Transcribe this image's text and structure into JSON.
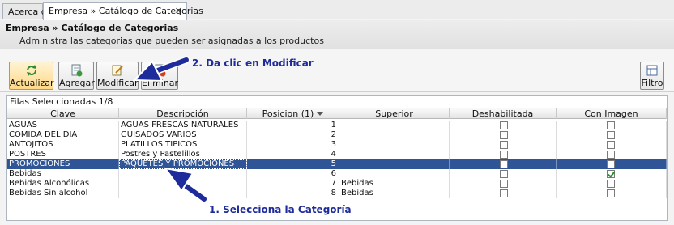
{
  "tabs": [
    {
      "label": "Acerca de"
    },
    {
      "label": "Empresa » Catálogo de Categorias",
      "close": "✕"
    }
  ],
  "header": {
    "title": "Empresa » Catálogo de Categorias",
    "description": "Administra las categorias que pueden ser asignadas a los productos"
  },
  "toolbar": {
    "actualizar": "Actualizar",
    "agregar": "Agregar",
    "modificar": "Modificar",
    "eliminar": "Eliminar",
    "filtro": "Filtro"
  },
  "grid": {
    "selected_label": "Filas Seleccionadas  1/8",
    "columns": [
      "Clave",
      "Descripción",
      "Posicion (1)",
      "Superior",
      "Deshabilitada",
      "Con Imagen"
    ],
    "rows": [
      {
        "clave": "AGUAS",
        "descripcion": "AGUAS FRESCAS NATURALES",
        "posicion": "1",
        "superior": "",
        "deshabilitada": false,
        "con_imagen": false
      },
      {
        "clave": "COMIDA DEL DIA",
        "descripcion": "GUISADOS VARIOS",
        "posicion": "2",
        "superior": "",
        "deshabilitada": false,
        "con_imagen": false
      },
      {
        "clave": "ANTOJITOS",
        "descripcion": "PLATILLOS TIPICOS",
        "posicion": "3",
        "superior": "",
        "deshabilitada": false,
        "con_imagen": false
      },
      {
        "clave": "POSTRES",
        "descripcion": "Postres y Pastelillos",
        "posicion": "4",
        "superior": "",
        "deshabilitada": false,
        "con_imagen": false
      },
      {
        "clave": "PROMOCIONES",
        "descripcion": "PAQUETES Y PROMOCIONES",
        "posicion": "5",
        "superior": "",
        "deshabilitada": false,
        "con_imagen": false
      },
      {
        "clave": "Bebidas",
        "descripcion": "",
        "posicion": "6",
        "superior": "",
        "deshabilitada": false,
        "con_imagen": true
      },
      {
        "clave": "Bebidas Alcohólicas",
        "descripcion": "",
        "posicion": "7",
        "superior": "Bebidas",
        "deshabilitada": false,
        "con_imagen": false
      },
      {
        "clave": "Bebidas Sin alcohol",
        "descripcion": "",
        "posicion": "8",
        "superior": "Bebidas",
        "deshabilitada": false,
        "con_imagen": false
      }
    ],
    "selected_row": 4
  },
  "annotations": {
    "step1": "1. Selecciona la Categoría",
    "step2": "2. Da clic en Modificar"
  },
  "colors": {
    "selected_row": "#2f5597",
    "annotation": "#1e2b9a"
  }
}
